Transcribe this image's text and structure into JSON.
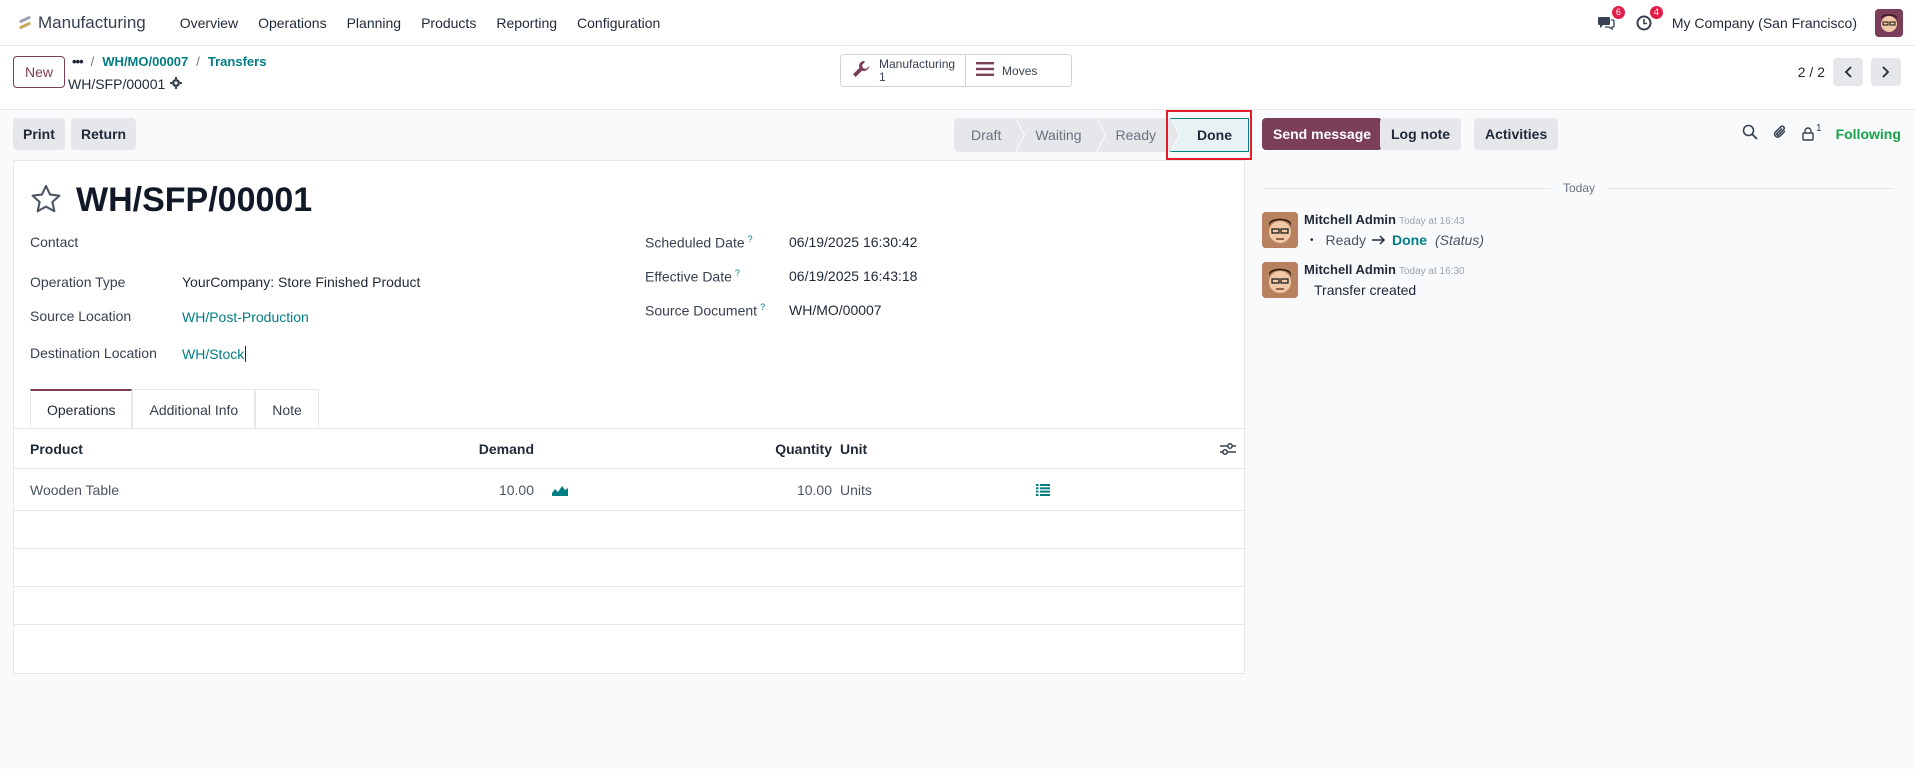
{
  "navbar": {
    "app_name": "Manufacturing",
    "menu": [
      "Overview",
      "Operations",
      "Planning",
      "Products",
      "Reporting",
      "Configuration"
    ],
    "messages_count": "6",
    "activities_count": "4",
    "company": "My Company (San Francisco)"
  },
  "control": {
    "new_label": "New",
    "breadcrumb_dots": "•••",
    "breadcrumb": [
      "WH/MO/00007",
      "Transfers"
    ],
    "record_name": "WH/SFP/00001",
    "smart_buttons": [
      {
        "label": "Manufacturing",
        "count": "1",
        "icon": "wrench-icon"
      },
      {
        "label": "Moves",
        "icon": "list-icon"
      }
    ],
    "pager": "2 / 2"
  },
  "toolbar": {
    "print": "Print",
    "return": "Return"
  },
  "statusbar": {
    "steps": [
      "Draft",
      "Waiting",
      "Ready",
      "Done"
    ],
    "active": "Done"
  },
  "form": {
    "title": "WH/SFP/00001",
    "labels": {
      "contact": "Contact",
      "operation_type": "Operation Type",
      "source_location": "Source Location",
      "destination_location": "Destination Location",
      "scheduled_date": "Scheduled Date",
      "effective_date": "Effective Date",
      "source_document": "Source Document",
      "help": "?"
    },
    "values": {
      "operation_type": "YourCompany: Store Finished Product",
      "source_location": "WH/Post-Production",
      "destination_location": "WH/Stock",
      "scheduled_date": "06/19/2025 16:30:42",
      "effective_date": "06/19/2025 16:43:18",
      "source_document": "WH/MO/00007"
    },
    "tabs": [
      "Operations",
      "Additional Info",
      "Note"
    ],
    "table": {
      "columns": {
        "product": "Product",
        "demand": "Demand",
        "quantity": "Quantity",
        "unit": "Unit"
      },
      "rows": [
        {
          "product": "Wooden Table",
          "demand": "10.00",
          "quantity": "10.00",
          "unit": "Units"
        }
      ]
    }
  },
  "chatter": {
    "send_message": "Send message",
    "log_note": "Log note",
    "activities": "Activities",
    "followers_count": "1",
    "following": "Following",
    "day": "Today",
    "messages": [
      {
        "author": "Mitchell Admin",
        "time": "Today at 16:43",
        "from": "Ready",
        "to": "Done",
        "field": "(Status)"
      },
      {
        "author": "Mitchell Admin",
        "time": "Today at 16:30",
        "text": "Transfer created"
      }
    ]
  },
  "colors": {
    "primary": "#7b3f5a",
    "link": "#017e84",
    "following": "#16a34a",
    "badge": "#e11d48"
  }
}
